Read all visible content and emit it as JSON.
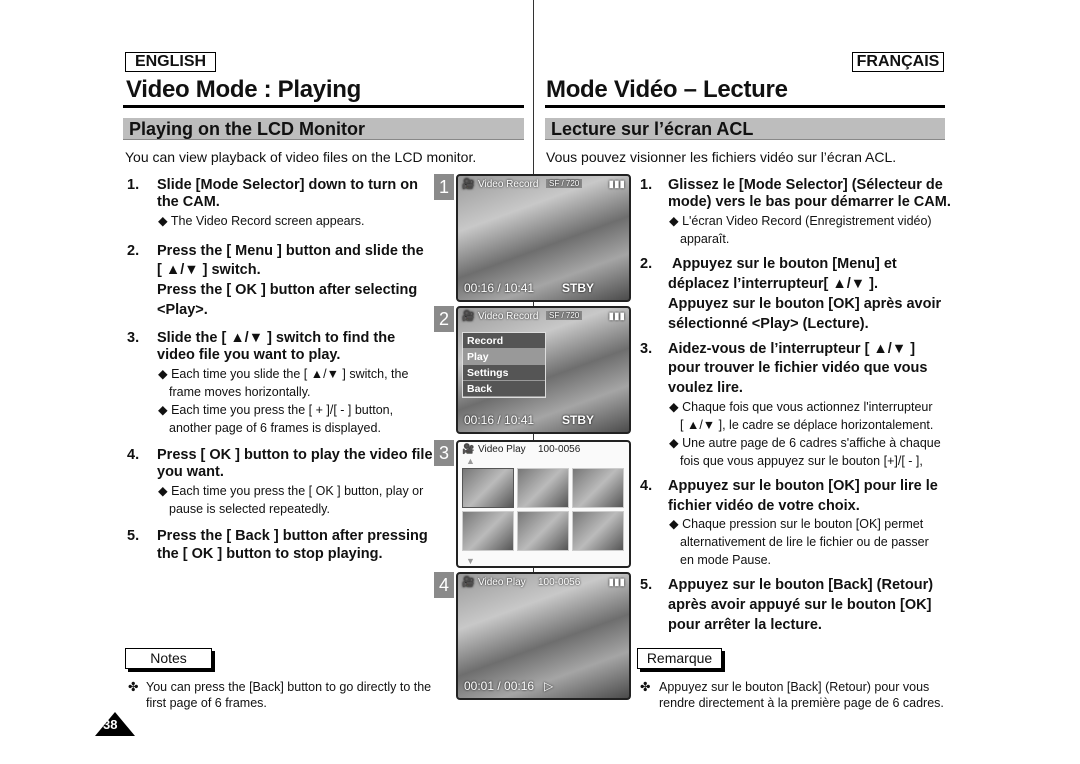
{
  "en": {
    "lang": "ENGLISH",
    "title": "Video Mode : Playing",
    "section": "Playing on the LCD Monitor",
    "intro": "You can view playback of video files on the LCD monitor.",
    "lines": [
      "1.",
      "Slide [Mode Selector] down to turn on",
      "the CAM.",
      "◆ The Video Record screen appears.",
      "2.",
      "Press the [ Menu ] button and slide the",
      "[ ▲/▼ ] switch.",
      "Press the [ OK ] button after selecting",
      "<Play>.",
      "3.",
      "Slide the [ ▲/▼ ] switch to find the",
      "video file you want to play.",
      "◆ Each time you slide the [ ▲/▼ ] switch, the",
      "frame moves horizontally.",
      "◆ Each time you press the [ + ]/[ - ] button,",
      "another page of 6 frames is displayed.",
      "4.",
      "Press [ OK ] button to play the video file",
      "you want.",
      "◆ Each time you press the [ OK ] button, play or",
      "pause is selected repeatedly.",
      "5.",
      "Press the [ Back ] button after pressing",
      "the [ OK ] button to stop playing."
    ],
    "notes_label": "Notes",
    "note_bullet": "✤",
    "note": "You can press the [Back] button to go directly to the first page of 6 frames."
  },
  "fr": {
    "lang": "FRANÇAIS",
    "title": "Mode Vidéo – Lecture",
    "section": "Lecture sur l’écran ACL",
    "intro": "Vous pouvez visionner les fichiers vidéo sur l’écran ACL.",
    "lines": [
      "1.",
      "Glissez le [Mode Selector] (Sélecteur de",
      "mode) vers le bas pour démarrer le CAM.",
      "◆ L'écran Video Record (Enregistrement vidéo)",
      "apparaît.",
      "2.",
      "Appuyez sur le bouton [Menu] et",
      "déplacez l’interrupteur[ ▲/▼ ].",
      "Appuyez sur le bouton [OK] après avoir",
      "sélectionné <Play> (Lecture).",
      "3.",
      "Aidez-vous de l’interrupteur [ ▲/▼ ]",
      "pour trouver le fichier vidéo que vous",
      "voulez lire.",
      "◆ Chaque fois que vous actionnez l'interrupteur",
      "[ ▲/▼ ], le cadre se déplace horizontalement.",
      "◆ Une autre page de 6 cadres s'affiche à chaque",
      "fois que vous appuyez sur le bouton [+]/[ - ],",
      "4.",
      "Appuyez sur le bouton [OK] pour lire le",
      "fichier vidéo de votre choix.",
      "◆ Chaque pression sur le bouton [OK] permet",
      "alternativement de lire le fichier ou de passer",
      "en mode Pause.",
      "5.",
      "Appuyez sur le bouton [Back] (Retour)",
      "après avoir appuyé sur le bouton [OK]",
      "pour arrêter la lecture."
    ],
    "notes_label": "Remarque",
    "note_bullet": "✤",
    "note": "Appuyez sur le bouton [Back] (Retour) pour vous rendre directement à la première page de 6 cadres."
  },
  "screens": [
    {
      "num": "1",
      "mode": "Video Record",
      "badge": "SF / 720",
      "time": "00:16 / 10:41",
      "status": "STBY"
    },
    {
      "num": "2",
      "mode": "Video Record",
      "badge": "SF / 720",
      "time": "00:16 / 10:41",
      "status": "STBY",
      "menu": [
        "Record",
        "Play",
        "Settings",
        "Back"
      ]
    },
    {
      "num": "3",
      "mode": "Video Play",
      "file": "100-0056"
    },
    {
      "num": "4",
      "mode": "Video Play",
      "file": "100-0056",
      "time": "00:01 / 00:16",
      "status": "▷"
    }
  ],
  "page_number": "38"
}
